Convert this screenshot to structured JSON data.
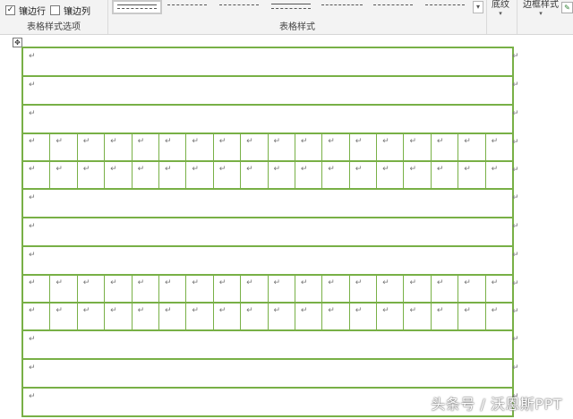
{
  "ribbon": {
    "options_group": {
      "banded_rows_label": "镶边行",
      "banded_cols_label": "镶边列",
      "banded_rows_checked": true,
      "banded_cols_checked": false,
      "group_label": "表格样式选项"
    },
    "styles_group": {
      "group_label": "表格样式"
    },
    "shading_label": "底纹",
    "border_styles_label": "边框样式"
  },
  "document": {
    "paragraph_mark": "↵",
    "move_handle_icon": "move-icon",
    "table": {
      "border_color": "#78b046",
      "rows": [
        {
          "type": "full"
        },
        {
          "type": "full"
        },
        {
          "type": "full"
        },
        {
          "type": "split",
          "cells": 18
        },
        {
          "type": "split",
          "cells": 18
        },
        {
          "type": "full"
        },
        {
          "type": "full"
        },
        {
          "type": "full"
        },
        {
          "type": "split",
          "cells": 18
        },
        {
          "type": "split",
          "cells": 18
        },
        {
          "type": "full"
        },
        {
          "type": "full"
        },
        {
          "type": "full"
        }
      ]
    }
  },
  "watermark": "头条号 / 沃恩斯PPT"
}
